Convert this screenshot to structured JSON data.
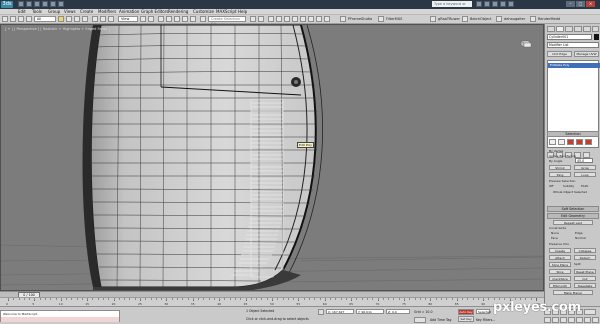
{
  "titlebar": {
    "app_logo": "3ds",
    "title": "",
    "search_placeholder": "Type a keyword or phrase",
    "min_label": "–",
    "max_label": "□",
    "close_label": "×"
  },
  "menu": [
    "Edit",
    "Tools",
    "Group",
    "Views",
    "Create",
    "Modifiers",
    "Animation",
    "Graph Editors",
    "Rendering",
    "Customize",
    "MAXScript",
    "Help"
  ],
  "toolbar": {
    "selection_filter": "All",
    "ref_coord": "View",
    "named_selection": "Create Selection Set",
    "label_left": "PFrameStudio",
    "label_mid1": "FilterMXS",
    "label_mid2": "gRaoTRuwer",
    "label_mid3": "BatchObject",
    "label_mid4": "dehaugalter",
    "label_right": "RenderMedd"
  },
  "viewport": {
    "label": "[ + ] [ Perspective ] [ Realistic + Highlights + Edged Faces ]",
    "tooltip": "Edit Poly"
  },
  "command_panel": {
    "object_name": "Cylinder001",
    "modifier_list": "Modifier List",
    "stack_item": "Editable Poly",
    "button_1": "Unit Edge",
    "button_2": "Manage UVW",
    "selection_rollout": "Selection",
    "by_vertex": "By Vertex",
    "ignore_backfacing": "Ignore Backfacing",
    "by_angle": "By Angle",
    "angle_value": "45.0",
    "shrink": "Shrink",
    "grow": "Grow",
    "ring": "Ring",
    "loop": "Loop",
    "preview_selection": "Preview Selection",
    "preview_off": "Off",
    "preview_subobj": "SubObj",
    "preview_multi": "Multi",
    "whole_object_selected": "Whole Object Selected",
    "soft_selection_rollout": "Soft Selection",
    "edit_geometry_rollout": "Edit Geometry",
    "repeat_last": "Repeat Last",
    "constraints": "Constraints",
    "c_none": "None",
    "c_edge": "Edge",
    "c_face": "Face",
    "c_normal": "Normal",
    "preserve_uvs": "Preserve UVs",
    "create": "Create",
    "collapse": "Collapse",
    "attach": "Attach",
    "detach": "Detach",
    "slice_plane": "Slice Plane",
    "split": "Split",
    "slice": "Slice",
    "reset_plane": "Reset Plane",
    "quickslice": "QuickSlice",
    "cut": "Cut",
    "msmooth": "MSmooth",
    "tessellate": "Tessellate",
    "make_planar": "Make Planar"
  },
  "timeline": {
    "frame_display": "0 / 100",
    "ticks": [
      "0",
      "5",
      "10",
      "15",
      "20",
      "25",
      "30",
      "35",
      "40",
      "45",
      "50",
      "55",
      "60",
      "65",
      "70",
      "75",
      "80",
      "85",
      "90",
      "95",
      "100"
    ]
  },
  "statusbar": {
    "maxscript_text": "Welcome to MAXScript.",
    "object_selected": "1 Object Selected",
    "prompt": "Click or click-and-drag to select objects",
    "x_value": "X: 167.627",
    "y_value": "Y: 96.011",
    "z_value": "Z: 0.0",
    "grid": "Grid = 10.0",
    "auto_key": "Auto Key",
    "set_key": "Set Key",
    "selected": "Selected",
    "add_time_tag": "Add Time Tag",
    "key_filters": "Key Filters..."
  },
  "colors": {
    "viewport_bg": "#7c7c7c",
    "mesh_face": "#d6d6d6",
    "wire": "#202020",
    "highlight": "#f1d763",
    "selection_blue": "#3f6fb7"
  },
  "watermark": "pxleyes.com"
}
